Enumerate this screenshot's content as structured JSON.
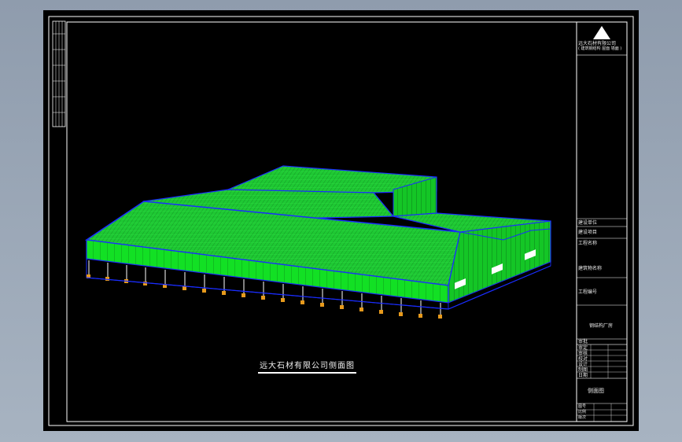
{
  "drawing": {
    "title": "远大石材有限公司侧面图",
    "company": "远大石材有限公司",
    "company_sub": "( 建筑钢结构 屋面 墙面 )",
    "view_name": "侧面图"
  },
  "title_block": {
    "rows": [
      "建设单位",
      "建设项目",
      "工程名称",
      "建筑物名称",
      "工程编号"
    ],
    "project_note": "钢结构厂房",
    "approval": "审批",
    "sign_rows": [
      "审定",
      "审核",
      "校对",
      "设计",
      "制图",
      "日期"
    ],
    "bottom_rows": [
      "图号",
      "比例",
      "版次"
    ]
  },
  "colors": {
    "roof": "#1ec833",
    "wall": "#12e024",
    "outline": "#1a2dff",
    "frame": "#ffffff",
    "viewport_bg": "#9aa7b6"
  },
  "icons": [
    "company-logo-triangle-icon"
  ]
}
